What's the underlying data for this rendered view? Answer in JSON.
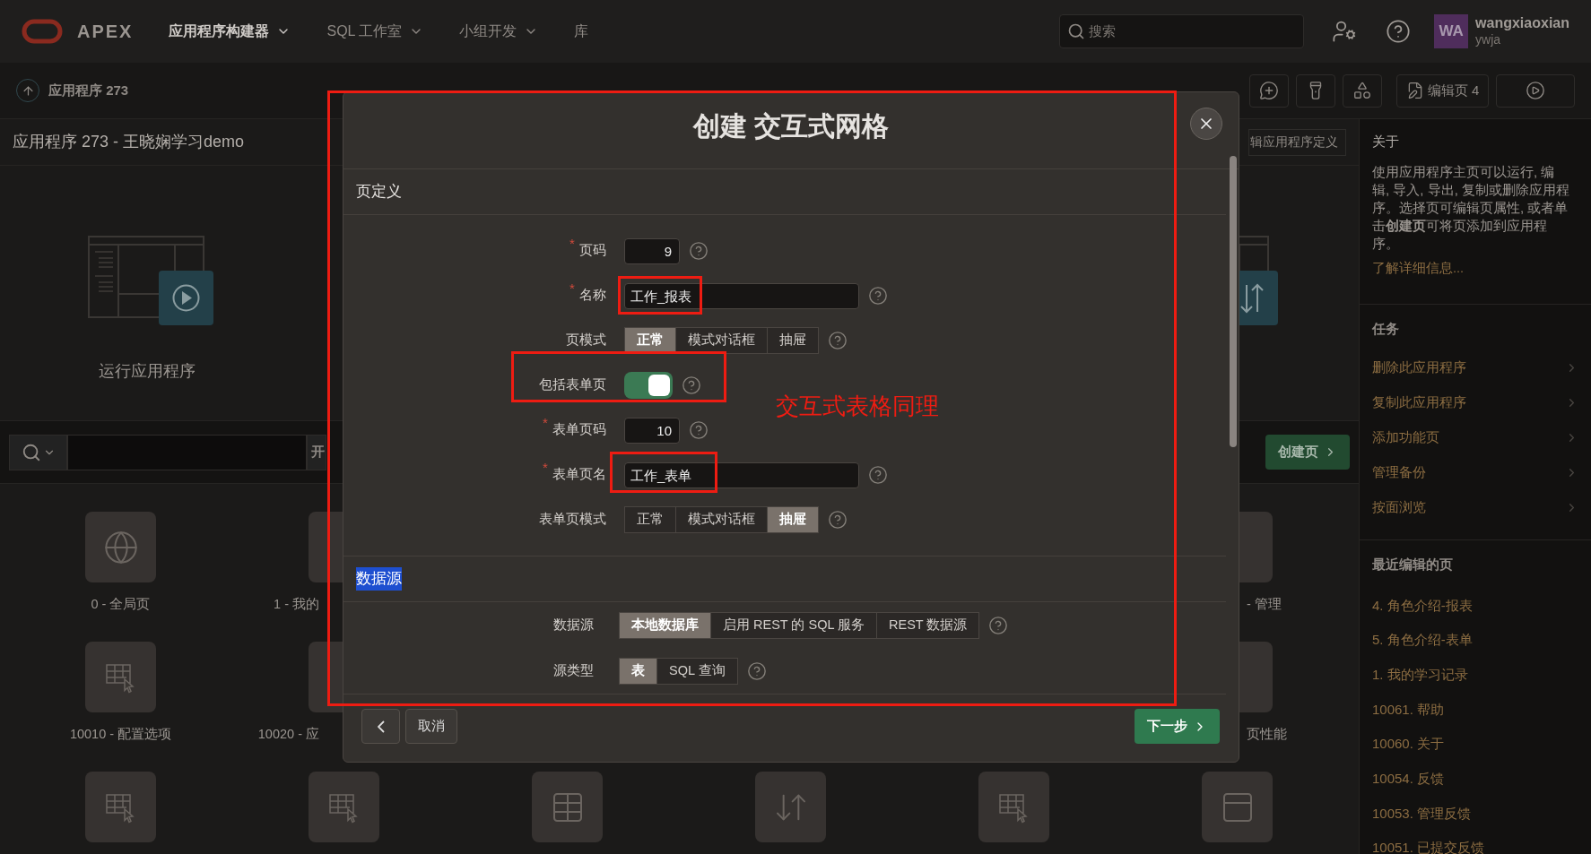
{
  "header": {
    "logo_text": "APEX",
    "nav": [
      {
        "label": "应用程序构建器",
        "selected": true,
        "dropdown": true
      },
      {
        "label": "SQL 工作室",
        "selected": false,
        "dropdown": true
      },
      {
        "label": "小组开发",
        "selected": false,
        "dropdown": true
      },
      {
        "label": "库",
        "selected": false,
        "dropdown": false
      }
    ],
    "search": {
      "placeholder": "搜索"
    },
    "user": {
      "initials": "WA",
      "name": "wangxiaoxian",
      "workspace": "ywja"
    }
  },
  "toolbar": {
    "breadcrumb": "应用程序 273",
    "edit_page_button": "编辑页 4"
  },
  "app_title": "应用程序 273 - 王晓娴学习demo",
  "run_card": {
    "label": "运行应用程序"
  },
  "edit_definition_button": "辑应用程序定义",
  "search_bar": {
    "go_button": "开"
  },
  "create_page_button": "创建页",
  "tile_rows": [
    {
      "tiles": [
        {
          "kind": "globe",
          "label": "0 - 全局页"
        },
        {
          "kind": "partial",
          "label": "1 - 我的"
        },
        {
          "kind": "covered"
        },
        {
          "kind": "covered"
        },
        {
          "kind": "covered"
        },
        {
          "kind": "partial",
          "label": "- 管理"
        }
      ]
    },
    {
      "tiles": [
        {
          "kind": "grid-cursor",
          "label": "10010 - 配置选项"
        },
        {
          "kind": "partial",
          "label": "10020 - 应"
        },
        {
          "kind": "covered"
        },
        {
          "kind": "covered"
        },
        {
          "kind": "covered"
        },
        {
          "kind": "partial",
          "label": "页性能"
        }
      ]
    },
    {
      "tiles": [
        {
          "kind": "grid-cursor"
        },
        {
          "kind": "grid-cursor"
        },
        {
          "kind": "table"
        },
        {
          "kind": "upload"
        },
        {
          "kind": "grid-cursor"
        },
        {
          "kind": "layout"
        }
      ]
    }
  ],
  "sidebar": {
    "about": {
      "title": "关于",
      "text": "使用应用程序主页可以运行, 编辑, 导入, 导出, 复制或删除应用程序。选择页可编辑页属性, 或者单击**创建页**可将页添加到应用程序。",
      "link": "了解详细信息..."
    },
    "tasks": {
      "title": "任务",
      "items": [
        "删除此应用程序",
        "复制此应用程序",
        "添加功能页",
        "管理备份",
        "按面浏览"
      ]
    },
    "recent": {
      "title": "最近编辑的页",
      "items": [
        "4. 角色介绍-报表",
        "5. 角色介绍-表单",
        "1. 我的学习记录",
        "10061. 帮助",
        "10060. 关于",
        "10054. 反馈",
        "10053. 管理反馈",
        "10051. 已提交反馈"
      ]
    }
  },
  "dialog": {
    "title": "创建 交互式网格",
    "sections": [
      {
        "title": "页定义",
        "highlighted": false,
        "fields": [
          {
            "kind": "number",
            "label": "页码",
            "required_mark": "*",
            "value": "9"
          },
          {
            "kind": "text",
            "label": "名称",
            "required_mark": "*",
            "value": "工作_报表"
          },
          {
            "kind": "segmented",
            "label": "页模式",
            "options": [
              {
                "label": "正常",
                "selected": true
              },
              {
                "label": "模式对话框",
                "selected": false
              },
              {
                "label": "抽屉",
                "selected": false
              }
            ]
          },
          {
            "kind": "switch",
            "label": "包括表单页",
            "on": true
          },
          {
            "kind": "number",
            "label": "表单页码",
            "required_mark": "*",
            "value": "10"
          },
          {
            "kind": "text",
            "label": "表单页名",
            "required_mark": "*",
            "value": "工作_表单"
          },
          {
            "kind": "segmented",
            "label": "表单页模式",
            "options": [
              {
                "label": "正常",
                "selected": false
              },
              {
                "label": "模式对话框",
                "selected": false
              },
              {
                "label": "抽屉",
                "selected": true
              }
            ]
          }
        ]
      },
      {
        "title": "数据源",
        "highlighted": true,
        "fields": [
          {
            "kind": "segmented",
            "label": "数据源",
            "options": [
              {
                "label": "本地数据库",
                "selected": true
              },
              {
                "label": "启用 REST 的 SQL 服务",
                "selected": false
              },
              {
                "label": "REST 数据源",
                "selected": false
              }
            ]
          },
          {
            "kind": "segmented",
            "label": "源类型",
            "options": [
              {
                "label": "表",
                "selected": true
              },
              {
                "label": "SQL 查询",
                "selected": false
              }
            ]
          }
        ]
      }
    ],
    "footer": {
      "cancel": "取消",
      "next": "下一步"
    }
  },
  "annotation": {
    "note": "交互式表格同理"
  }
}
